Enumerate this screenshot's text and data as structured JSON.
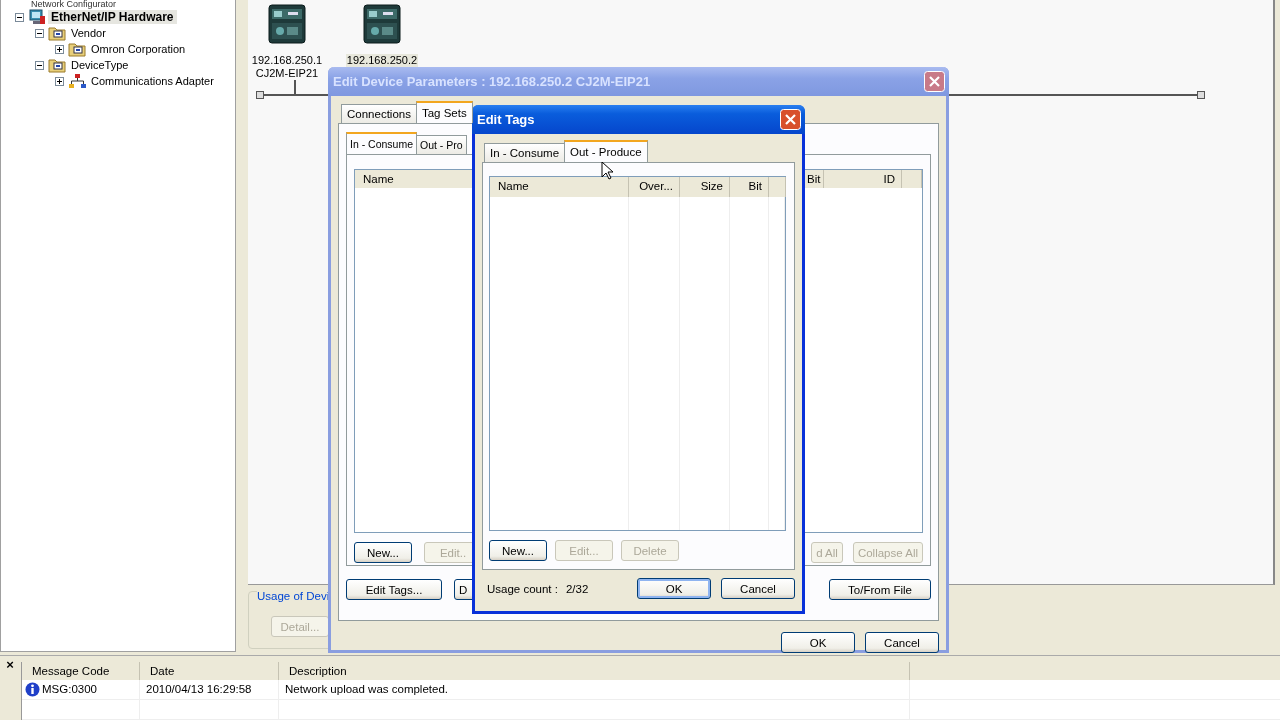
{
  "app_title": "Network Configurator",
  "tree": [
    {
      "label": "EtherNet/IP Hardware",
      "kind": "hardware",
      "selected": true,
      "expanded": true,
      "children": [
        {
          "label": "Vendor",
          "kind": "folder",
          "selected": false,
          "expanded": true,
          "children": [
            {
              "label": "Omron Corporation",
              "kind": "folder",
              "selected": false,
              "expanded": false
            }
          ]
        },
        {
          "label": "DeviceType",
          "kind": "folder",
          "selected": false,
          "expanded": true,
          "children": [
            {
              "label": "Communications Adapter",
              "kind": "adapter",
              "selected": false,
              "expanded": false
            }
          ]
        }
      ]
    }
  ],
  "network": {
    "nodes": [
      {
        "address": "192.168.250.1",
        "model": "CJ2M-EIP21",
        "selected": false
      },
      {
        "address": "192.168.250.2",
        "selected": true
      }
    ]
  },
  "usage_group": {
    "title": "Usage of Devi",
    "buttons": [
      {
        "label": "Detail...",
        "disabled": true
      }
    ]
  },
  "device_dialog": {
    "title": "Edit Device Parameters : 192.168.250.2 CJ2M-EIP21",
    "tabs": [
      {
        "label": "Connections",
        "selected": false
      },
      {
        "label": "Tag Sets",
        "selected": true
      }
    ],
    "sub_tabs": [
      {
        "label": "In - Consume",
        "selected": true
      },
      {
        "label": "Out - Pro",
        "selected": false
      }
    ],
    "columns": [
      "Name",
      "Bit",
      "ID"
    ],
    "table_buttons_left": [
      {
        "label": "New...",
        "disabled": false
      },
      {
        "label": "Edit..",
        "disabled": true
      }
    ],
    "table_buttons_right": [
      {
        "label": "d All",
        "disabled": true
      },
      {
        "label": "Collapse All",
        "disabled": true
      }
    ],
    "panel_buttons_left": [
      {
        "label": "Edit Tags...",
        "disabled": false
      },
      {
        "label": "D",
        "disabled": false
      }
    ],
    "panel_buttons_right": [
      {
        "label": "To/From File",
        "disabled": false
      }
    ],
    "buttons": [
      {
        "label": "OK",
        "disabled": false
      },
      {
        "label": "Cancel",
        "disabled": false
      }
    ]
  },
  "tags_dialog": {
    "title": "Edit Tags",
    "tabs": [
      {
        "label": "In - Consume",
        "selected": false
      },
      {
        "label": "Out - Produce",
        "selected": true
      }
    ],
    "columns": [
      "Name",
      "Over...",
      "Size",
      "Bit"
    ],
    "table_buttons": [
      {
        "label": "New...",
        "disabled": false
      },
      {
        "label": "Edit...",
        "disabled": true
      },
      {
        "label": "Delete",
        "disabled": true
      }
    ],
    "usage_label": "Usage count :",
    "usage_value": "2/32",
    "buttons": [
      {
        "label": "OK",
        "disabled": false,
        "default": true
      },
      {
        "label": "Cancel",
        "disabled": false,
        "default": false
      }
    ]
  },
  "messages": {
    "close": "×",
    "columns": [
      "Message Code",
      "Date",
      "Description"
    ],
    "rows": [
      {
        "kind": "info",
        "code": "MSG:0300",
        "date": "2010/04/13 16:29:58",
        "description": "Network upload was completed."
      }
    ]
  }
}
